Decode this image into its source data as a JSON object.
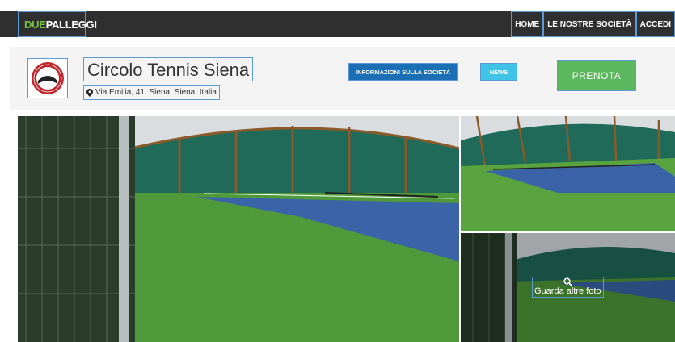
{
  "brand": {
    "logo_prefix": "DUE",
    "logo_suffix": "PALLEGGI"
  },
  "nav": {
    "items": [
      "HOME",
      "LE NOSTRE SOCIETÀ",
      "ACCEDI"
    ]
  },
  "club": {
    "name": "Circolo Tennis Siena",
    "address": "Via Emilia, 41, Siena, Siena, Italia"
  },
  "actions": {
    "info_label": "INFORMAZIONI SULLA SOCIETÀ",
    "news_label": "NEWS",
    "book_label": "PRENOTA"
  },
  "gallery": {
    "more_label": "Guarda altre foto"
  },
  "colors": {
    "topbar": "#2f2f2f",
    "brand_green": "#7ac143",
    "info_button": "#1a6fb5",
    "news_button": "#3fc3e6",
    "book_button": "#5cb85c",
    "court_green": "#4f9a3a",
    "court_blue": "#3a63a8"
  }
}
